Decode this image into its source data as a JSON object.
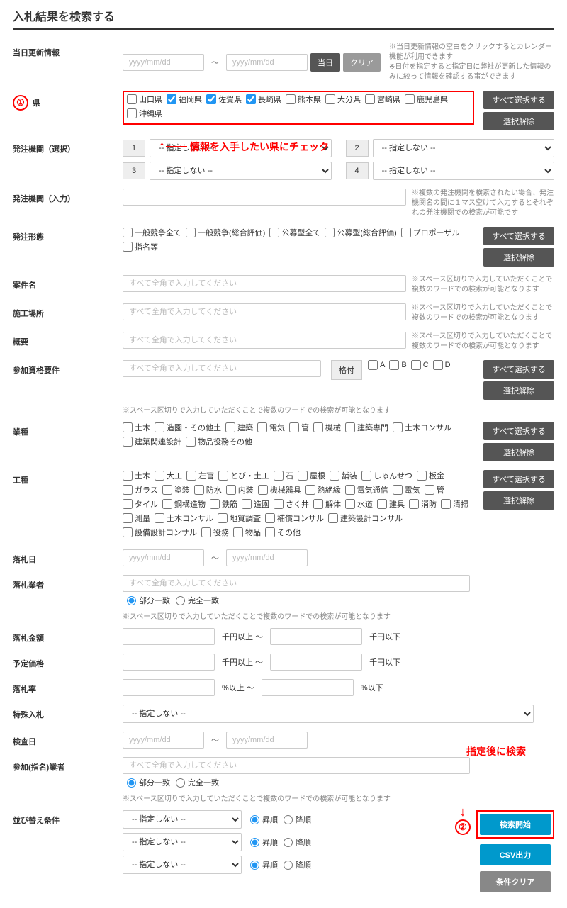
{
  "title": "入札結果を検索する",
  "labels": {
    "update_info": "当日更新情報",
    "prefecture": "県",
    "agency_select": "発注機関（選択）",
    "agency_input": "発注機関（入力）",
    "order_type": "発注形態",
    "project_name": "案件名",
    "work_place": "施工場所",
    "summary": "概要",
    "qualification": "参加資格要件",
    "industry": "業種",
    "work_type": "工種",
    "award_date": "落札日",
    "winner": "落札業者",
    "award_amount": "落札金額",
    "planned_price": "予定価格",
    "award_rate": "落札率",
    "special_bid": "特殊入札",
    "inspection_date": "検査日",
    "participant": "参加(指名)業者",
    "sort": "並び替え条件"
  },
  "date_placeholder": "yyyy/mm/dd",
  "fullwidth_placeholder": "すべて全角で入力してください",
  "buttons": {
    "today": "当日",
    "clear": "クリア",
    "select_all": "すべて選択する",
    "deselect": "選択解除",
    "search": "検索開始",
    "csv": "CSV出力",
    "reset": "条件クリア"
  },
  "prefectures": [
    "山口県",
    "福岡県",
    "佐賀県",
    "長崎県",
    "熊本県",
    "大分県",
    "宮崎県",
    "鹿児島県",
    "沖縄県"
  ],
  "pref_checked": [
    false,
    true,
    true,
    true,
    false,
    false,
    false,
    false,
    false
  ],
  "agency_numbers": [
    "1",
    "2",
    "3",
    "4"
  ],
  "select_none": "-- 指定しない --",
  "order_types": [
    "一般競争全て",
    "一般競争(総合評価)",
    "公募型全て",
    "公募型(総合評価)",
    "プロポーザル",
    "指名等"
  ],
  "grade_label": "格付",
  "grades": [
    "A",
    "B",
    "C",
    "D"
  ],
  "industries": [
    "土木",
    "造園・その他土",
    "建築",
    "電気",
    "管",
    "機械",
    "建築専門",
    "土木コンサル",
    "建築関連設計",
    "物品役務その他"
  ],
  "work_types": [
    "土木",
    "大工",
    "左官",
    "とび・土工",
    "石",
    "屋根",
    "舗装",
    "しゅんせつ",
    "板金",
    "ガラス",
    "塗装",
    "防水",
    "内装",
    "機械器具",
    "熱絶縁",
    "電気通信",
    "電気",
    "管",
    "タイル",
    "鋼構造物",
    "鉄筋",
    "造園",
    "さく井",
    "解体",
    "水道",
    "建具",
    "消防",
    "清掃",
    "測量",
    "土木コンサル",
    "地質調査",
    "補償コンサル",
    "建築設計コンサル",
    "設備設計コンサル",
    "役務",
    "物品",
    "その他"
  ],
  "units": {
    "sen_en_ijo": "千円以上 ～",
    "sen_en_ika": "千円以下",
    "pct_ijo": "%以上  ～",
    "pct_ika": "%以下"
  },
  "radio": {
    "partial": "部分一致",
    "exact": "完全一致",
    "asc": "昇順",
    "desc": "降順"
  },
  "notes": {
    "update": "※当日更新情報の空白をクリックするとカレンダー機能が利用できます\n※日付を指定すると指定日に弊社が更新した情報のみに絞って情報を確認する事ができます",
    "agency": "※複数の発注機関を検索されたい場合、発注機関名の間に１マス空けて入力するとそれぞれの発注機関での検索が可能です",
    "multi_word": "※スペース区切りで入力していただくことで複数のワードでの検索が可能となります",
    "multi_word2": "※スペース区切りで入力していただくことで複数のワードでの検索が可能となります"
  },
  "annotations": {
    "step1": "①",
    "step1_text": "情報を入手したい県にチェック",
    "step2": "②",
    "step2_text": "指定後に検索"
  }
}
